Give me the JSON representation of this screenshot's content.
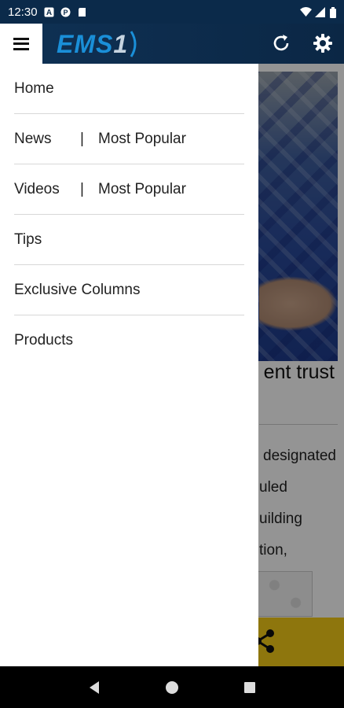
{
  "status_bar": {
    "time": "12:30",
    "left_icons": [
      "notification-a-icon",
      "notification-p-icon",
      "sd-card-icon"
    ],
    "right_icons": [
      "wifi-icon",
      "signal-icon",
      "battery-icon"
    ]
  },
  "header": {
    "logo_text": "EMS",
    "logo_number": "1",
    "refresh_icon": "refresh-icon",
    "settings_icon": "gear-icon",
    "menu_icon": "hamburger-menu-icon",
    "brand_color": "#1a8fd8",
    "background_color": "#0f3154"
  },
  "drawer": {
    "items": [
      {
        "label": "Home"
      },
      {
        "label": "News",
        "separator": "|",
        "sublabel": "Most Popular"
      },
      {
        "label": "Videos",
        "separator": "|",
        "sublabel": "Most Popular"
      },
      {
        "label": "Tips"
      },
      {
        "label": "Exclusive Columns"
      },
      {
        "label": "Products"
      }
    ]
  },
  "background_content": {
    "headline_fragment": "ent trust",
    "body_fragments": [
      "designated",
      "uled",
      "uilding",
      "tion,"
    ],
    "share_bar_color": "#f5cc17",
    "share_icon": "share-icon"
  },
  "nav_bar": {
    "back_icon": "back-triangle-icon",
    "home_icon": "home-circle-icon",
    "recents_icon": "recents-square-icon"
  }
}
